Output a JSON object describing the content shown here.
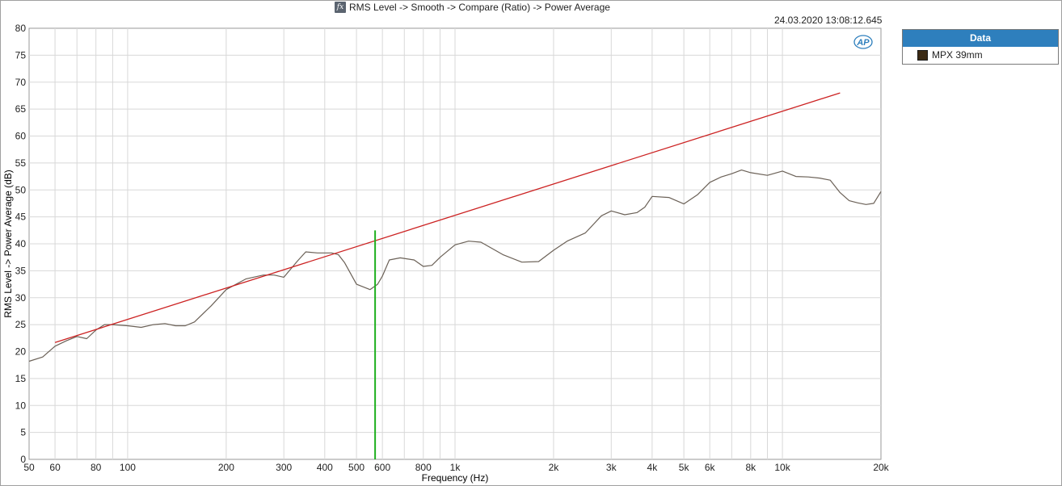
{
  "window": {
    "title": "RMS Level -> Smooth -> Compare (Ratio) -> Power Average",
    "timestamp": "24.03.2020 13:08:12.645",
    "fx_icon": "fx-icon",
    "logo": "AP"
  },
  "legend": {
    "header": "Data",
    "items": [
      {
        "label": "MPX 39mm",
        "color": "#3b2a14"
      }
    ]
  },
  "chart_data": {
    "type": "line",
    "xlabel": "Frequency (Hz)",
    "ylabel": "RMS Level -> Power Average (dB)",
    "x_scale": "log",
    "xlim": [
      50,
      20000
    ],
    "ylim": [
      0,
      80
    ],
    "grid": true,
    "legend_position": "right",
    "x_ticks": [
      50,
      60,
      80,
      100,
      200,
      300,
      400,
      500,
      600,
      800,
      1000,
      2000,
      3000,
      4000,
      5000,
      6000,
      8000,
      10000,
      20000
    ],
    "x_tick_labels": [
      "50",
      "60",
      "80",
      "100",
      "200",
      "300",
      "400",
      "500",
      "600",
      "800",
      "1k",
      "2k",
      "3k",
      "4k",
      "5k",
      "6k",
      "8k",
      "10k",
      "20k"
    ],
    "y_ticks": [
      0,
      5,
      10,
      15,
      20,
      25,
      30,
      35,
      40,
      45,
      50,
      55,
      60,
      65,
      70,
      75,
      80
    ],
    "series": [
      {
        "name": "MPX 39mm",
        "color": "#6b6157",
        "x": [
          50,
          55,
          60,
          65,
          70,
          75,
          80,
          85,
          90,
          100,
          110,
          120,
          130,
          140,
          150,
          160,
          180,
          200,
          230,
          260,
          280,
          300,
          330,
          350,
          380,
          420,
          440,
          460,
          500,
          550,
          580,
          600,
          630,
          680,
          750,
          800,
          850,
          900,
          1000,
          1100,
          1200,
          1400,
          1600,
          1800,
          2000,
          2200,
          2500,
          2800,
          3000,
          3300,
          3600,
          3800,
          4000,
          4500,
          5000,
          5500,
          6000,
          6500,
          7000,
          7500,
          8000,
          9000,
          10000,
          11000,
          12000,
          13000,
          14000,
          15000,
          16000,
          17000,
          18000,
          19000,
          20000
        ],
        "y": [
          18.2,
          19,
          21,
          22,
          22.8,
          22.4,
          24,
          25,
          25,
          24.8,
          24.5,
          25,
          25.2,
          24.8,
          24.8,
          25.5,
          28.5,
          31.5,
          33.5,
          34.2,
          34.2,
          33.8,
          36.8,
          38.5,
          38.3,
          38.3,
          38,
          36.5,
          32.5,
          31.5,
          32.5,
          34,
          37,
          37.4,
          37,
          35.8,
          36,
          37.5,
          39.8,
          40.5,
          40.3,
          38,
          36.6,
          36.7,
          38.8,
          40.5,
          42,
          45.2,
          46.1,
          45.4,
          45.8,
          46.8,
          48.8,
          48.6,
          47.4,
          49.1,
          51.4,
          52.4,
          53,
          53.7,
          53.2,
          52.7,
          53.5,
          52.5,
          52.4,
          52.2,
          51.8,
          49.5,
          48,
          47.6,
          47.3,
          47.5,
          49.7
        ]
      },
      {
        "name": "",
        "color": "#cc2222",
        "x": [
          60,
          15000
        ],
        "y": [
          21.7,
          68
        ]
      }
    ],
    "cursor": {
      "x": 570,
      "y_top": 42.5,
      "color": "#1fb01f"
    }
  }
}
